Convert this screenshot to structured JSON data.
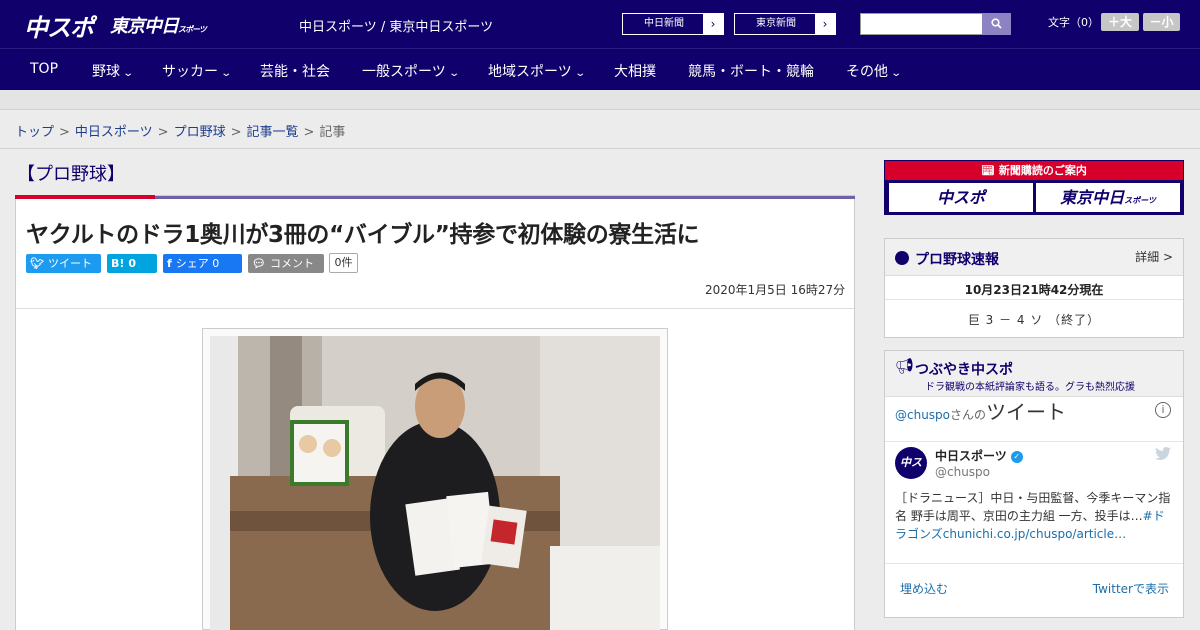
{
  "header": {
    "logo_chuspo": "中スポ",
    "logo_tokyo": "東京中日",
    "logo_tokyo_small": "スポーツ",
    "site_link": "中日スポーツ / 東京中日スポーツ",
    "ext_links": [
      {
        "label": "中日新聞",
        "arrow": "›"
      },
      {
        "label": "東京新聞",
        "arrow": "›"
      }
    ],
    "search_placeholder": "",
    "font_size_label": "文字（0）",
    "font_plus": "＋大",
    "font_minus": "－小"
  },
  "nav": {
    "items": [
      {
        "label": "TOP",
        "has_menu": false
      },
      {
        "label": "野球",
        "has_menu": true
      },
      {
        "label": "サッカー",
        "has_menu": true
      },
      {
        "label": "芸能・社会",
        "has_menu": false
      },
      {
        "label": "一般スポーツ",
        "has_menu": true
      },
      {
        "label": "地域スポーツ",
        "has_menu": true
      },
      {
        "label": "大相撲",
        "has_menu": false
      },
      {
        "label": "競馬・ボート・競輪",
        "has_menu": false
      },
      {
        "label": "その他",
        "has_menu": true
      }
    ]
  },
  "breadcrumb": {
    "items": [
      "トップ",
      "中日スポーツ",
      "プロ野球",
      "記事一覧"
    ],
    "current": "記事",
    "sep": ">"
  },
  "article": {
    "category": "【プロ野球】",
    "headline": "ヤクルトのドラ1奥川が3冊の“バイブル”持参で初体験の寮生活に",
    "share": {
      "tweet": "ツイート",
      "hatena_icon": "B!",
      "hatena_count": "0",
      "facebook": "シェア",
      "facebook_count": "0",
      "comment": "コメント",
      "comment_count": "0件"
    },
    "date": "2020年1月5日 16時27分"
  },
  "sidebar": {
    "promo": {
      "title": "新聞購読のご案内",
      "left": "中スポ",
      "right": "東京中日",
      "right_small": "スポーツ"
    },
    "baseball": {
      "title": "プロ野球速報",
      "detail": "詳細 >",
      "time": "10月23日21時42分現在",
      "score": "巨 3 － 4 ソ （終了）"
    },
    "tweets": {
      "title": "つぶやき中スポ",
      "subtitle": "ドラ観戦の本紙評論家も語る。グラも熱烈応援",
      "handle": "@chuspo",
      "handle_suffix": "さんの",
      "big_label": "ツイート",
      "info": "i",
      "avatar_text": "中スポ",
      "name": "中日スポーツ",
      "user": "@chuspo",
      "text_plain": "［ドラニュース］中日・与田監督、今季キーマン指名 野手は周平、京田の主力組 一方、投手は…",
      "text_link": "#ドラゴンズchunichi.co.jp/chuspo/article…",
      "embed": "埋め込む",
      "view": "Twitterで表示"
    }
  },
  "colors": {
    "navy": "#0f006b",
    "red": "#d6002a",
    "purple": "#6f60a8",
    "twitter": "#1d9bf0",
    "facebook": "#1877f2",
    "hatena": "#00a4de"
  }
}
